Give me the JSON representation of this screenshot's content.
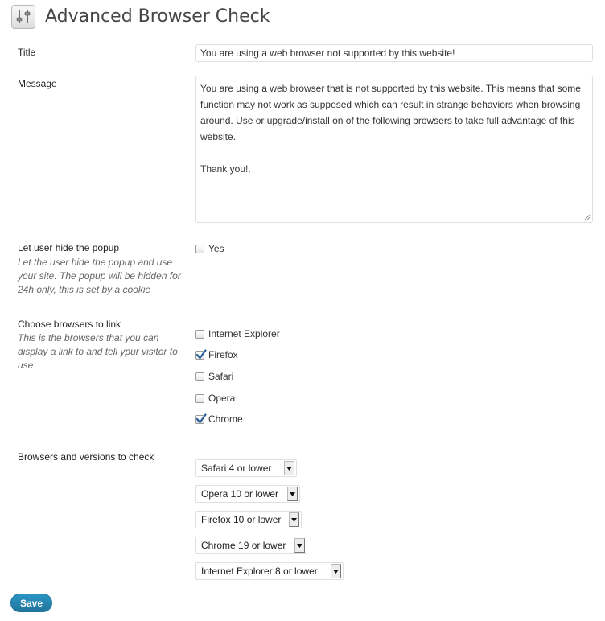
{
  "page": {
    "title": "Advanced Browser Check"
  },
  "icons": {
    "page": "settings-sliders-icon",
    "checkmark": "checkmark-icon",
    "dropdown": "triangle-down-icon"
  },
  "fields": {
    "title": {
      "label": "Title",
      "value": "You are using a web browser not supported by this website!"
    },
    "message": {
      "label": "Message",
      "value": "You are using a web browser that is not supported by this website. This means that some function may not work as supposed which can result in strange behaviors when browsing around. Use or upgrade/install on of the following browsers to take full advantage of this website.\n\nThank you!."
    },
    "hide_popup": {
      "label": "Let user hide the popup",
      "description": "Let the user hide the popup and use your site. The popup will be hidden for 24h only, this is set by a cookie",
      "option": {
        "label": "Yes",
        "checked": false
      }
    },
    "browsers_to_link": {
      "label": "Choose browsers to link",
      "description": "This is the browsers that you can display a link to and tell ypur visitor to use",
      "options": [
        {
          "label": "Internet Explorer",
          "checked": false
        },
        {
          "label": "Firefox",
          "checked": true
        },
        {
          "label": "Safari",
          "checked": false
        },
        {
          "label": "Opera",
          "checked": false
        },
        {
          "label": "Chrome",
          "checked": true
        }
      ]
    },
    "versions_to_check": {
      "label": "Browsers and versions to check",
      "selects": [
        {
          "value": "Safari 4 or lower"
        },
        {
          "value": "Opera 10 or lower"
        },
        {
          "value": "Firefox 10 or lower"
        },
        {
          "value": "Chrome 19 or lower"
        },
        {
          "value": "Internet Explorer 8 or lower"
        }
      ]
    }
  },
  "buttons": {
    "save": "Save"
  },
  "colors": {
    "accent": "#21759b",
    "checkmark": "#2b5d9b"
  }
}
